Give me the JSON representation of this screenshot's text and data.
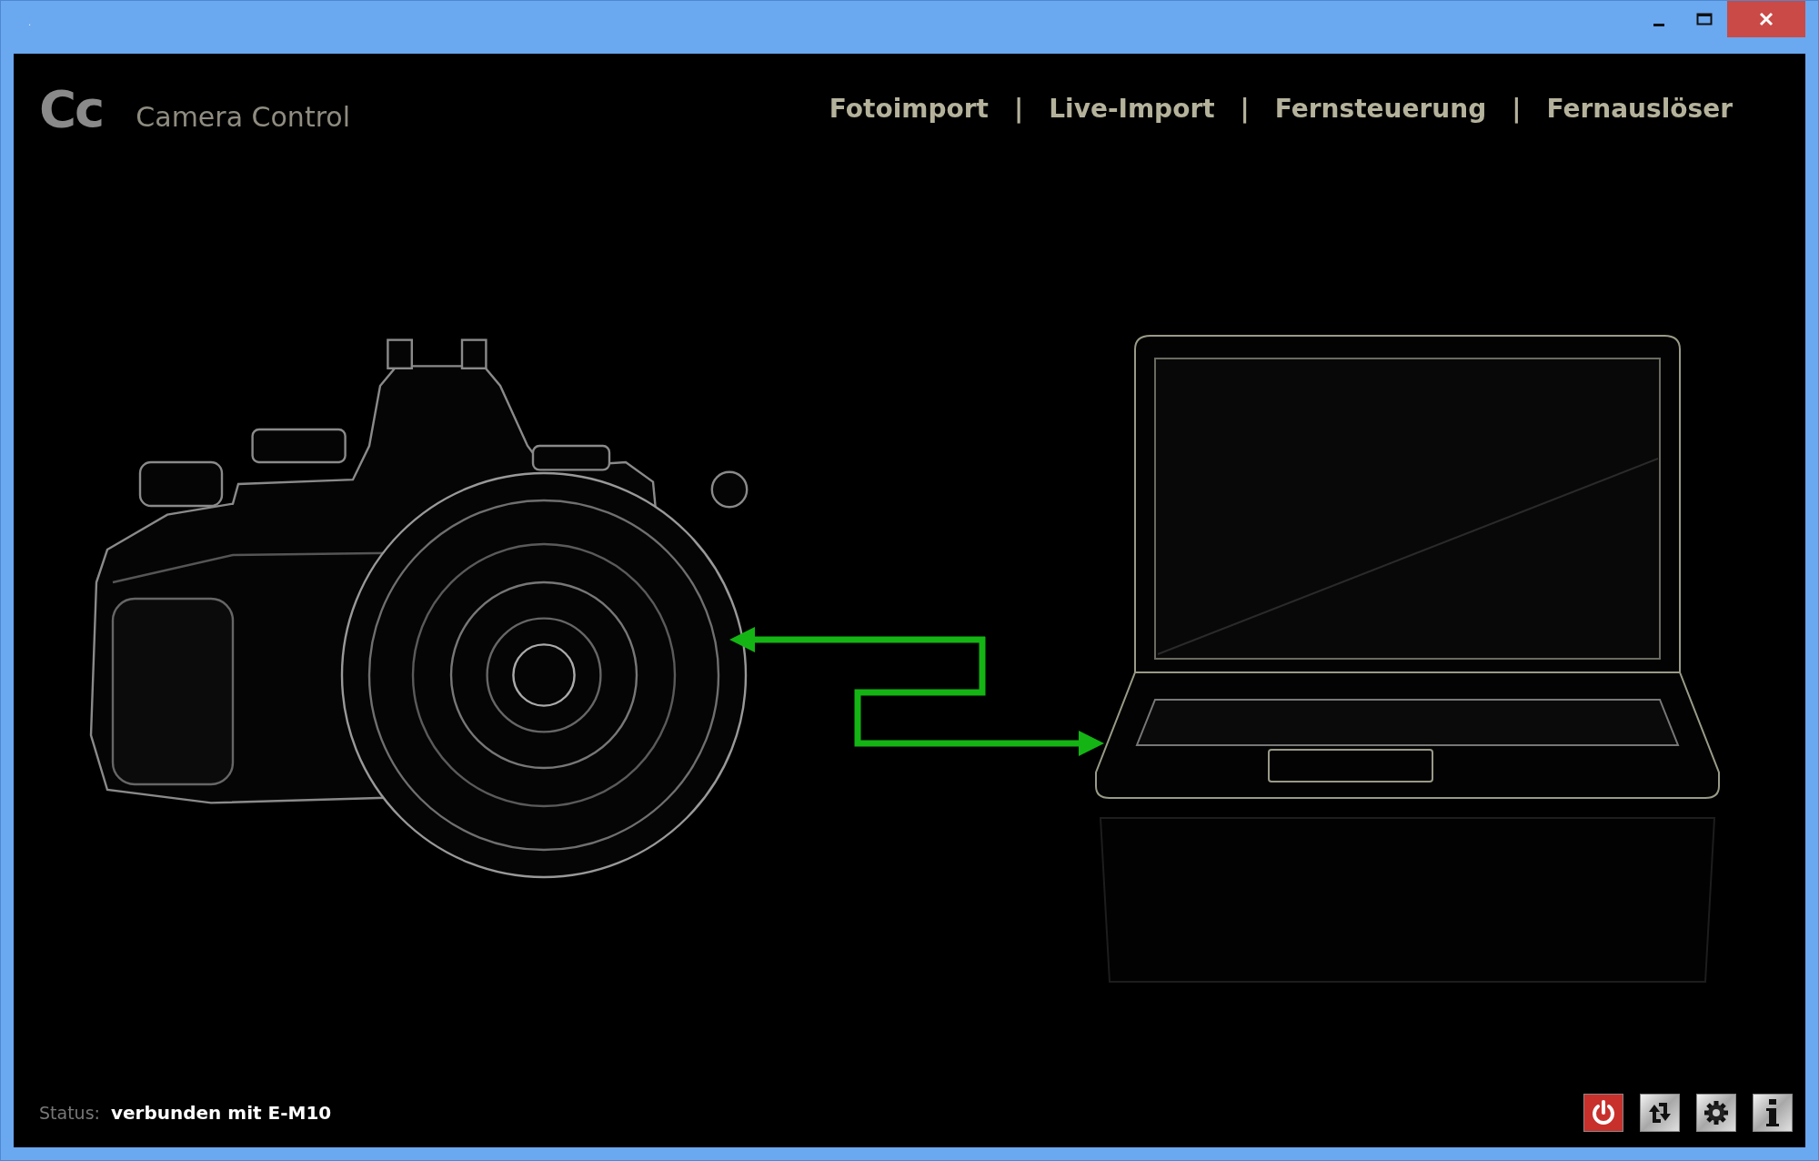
{
  "window": {
    "title_dot": ".",
    "controls": [
      {
        "kind": "minimize"
      },
      {
        "kind": "maximize"
      },
      {
        "kind": "close"
      }
    ]
  },
  "header": {
    "logo": "Cc",
    "app_name": "Camera Control"
  },
  "nav": [
    {
      "label": "Fotoimport"
    },
    {
      "label": "Live-Import"
    },
    {
      "label": "Fernsteuerung"
    },
    {
      "label": "Fernauslöser"
    }
  ],
  "nav_separator": "|",
  "status": {
    "label": "Status:",
    "value": "verbunden mit E-M10"
  },
  "toolbar": [
    {
      "kind": "power"
    },
    {
      "kind": "sync"
    },
    {
      "kind": "settings"
    },
    {
      "kind": "info"
    }
  ]
}
